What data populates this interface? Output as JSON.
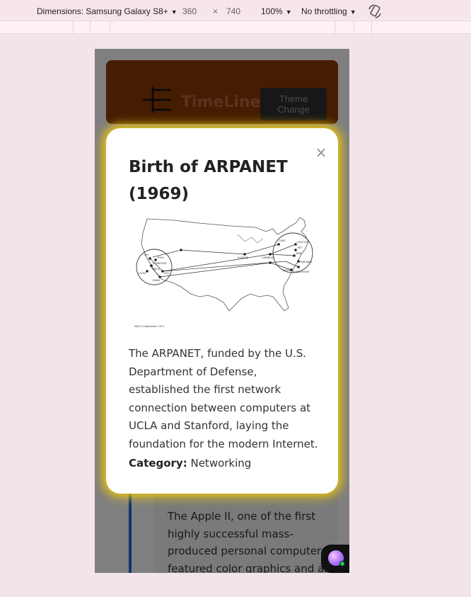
{
  "devtools": {
    "dimensions_label": "Dimensions: Samsung Galaxy S8+",
    "width": "360",
    "times": "×",
    "height": "740",
    "zoom": "100%",
    "throttling": "No throttling",
    "caret": "▼",
    "rotate_icon": "rotate-icon"
  },
  "app": {
    "brand": "TimeLine",
    "theme_button": "Theme Change",
    "header_color": "#8a3a06"
  },
  "modal": {
    "close": "×",
    "title": "Birth of ARPANET (1969)",
    "image_caption": "MAP 4   September 1971",
    "description": "The ARPANET, funded by the U.S. Department of Defense, established the first network connection between computers at UCLA and Stanford, laying the foundation for the modern Internet.",
    "category_label": "Category:",
    "category": "Networking",
    "glow_color": "#f0c80a"
  },
  "background_card": {
    "description": "The Apple II, one of the first highly successful mass-produced personal computers, featured color graphics and an open"
  },
  "map_labels": {
    "west_a": "SRI",
    "west_b": "UTAH",
    "west_c": "STANFORD",
    "west_d": "UCLA",
    "west_e": "UCSB",
    "west_f": "SDC",
    "west_g": "RAND",
    "mid_a": "CASE",
    "mid_b": "ILLINOIS",
    "mid_c": "CARNEGIE",
    "mid_d": "LINCOLN",
    "mid_e": "MIT",
    "mid_f": "BBN",
    "mid_g": "HARVARD",
    "mid_h": "BURROUGHS",
    "mid_i": "MITRE"
  }
}
